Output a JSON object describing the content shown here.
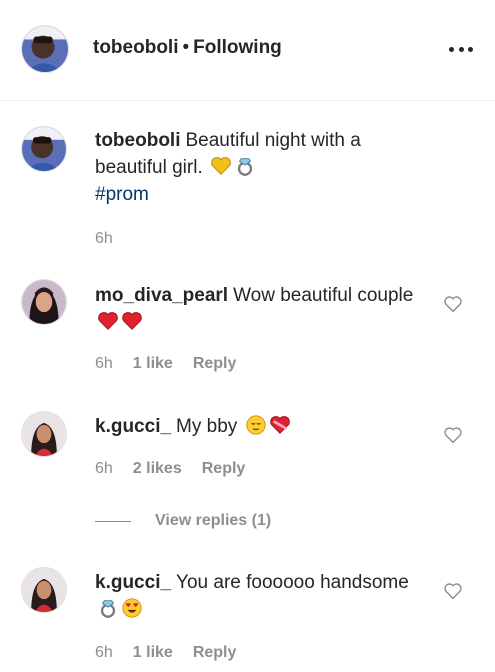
{
  "header": {
    "username": "tobeoboli",
    "separator": "•",
    "follow_status": "Following"
  },
  "caption": {
    "username": "tobeoboli",
    "text": "Beautiful night with a beautiful girl.",
    "emojis": [
      "yellow-heart-icon",
      "ring-icon"
    ],
    "hashtag": "#prom",
    "time": "6h"
  },
  "comments": [
    {
      "username": "mo_diva_pearl",
      "text": "Wow beautiful couple",
      "emojis": [
        "red-heart-icon",
        "red-heart-icon"
      ],
      "time": "6h",
      "likes": "1 like",
      "reply": "Reply"
    },
    {
      "username": "k.gucci_",
      "text": "My bby",
      "emojis": [
        "relieved-face-icon",
        "heart-with-ribbon-icon"
      ],
      "time": "6h",
      "likes": "2 likes",
      "reply": "Reply",
      "view_replies": "View replies (1)"
    },
    {
      "username": "k.gucci_",
      "text": "You are foooooo handsome",
      "emojis": [
        "ring-icon",
        "heart-eyes-face-icon"
      ],
      "time": "6h",
      "likes": "1 like",
      "reply": "Reply"
    }
  ],
  "colors": {
    "text": "#262626",
    "secondary": "#8e8e8e",
    "hashtag": "#00376b",
    "divider": "#efefef"
  }
}
